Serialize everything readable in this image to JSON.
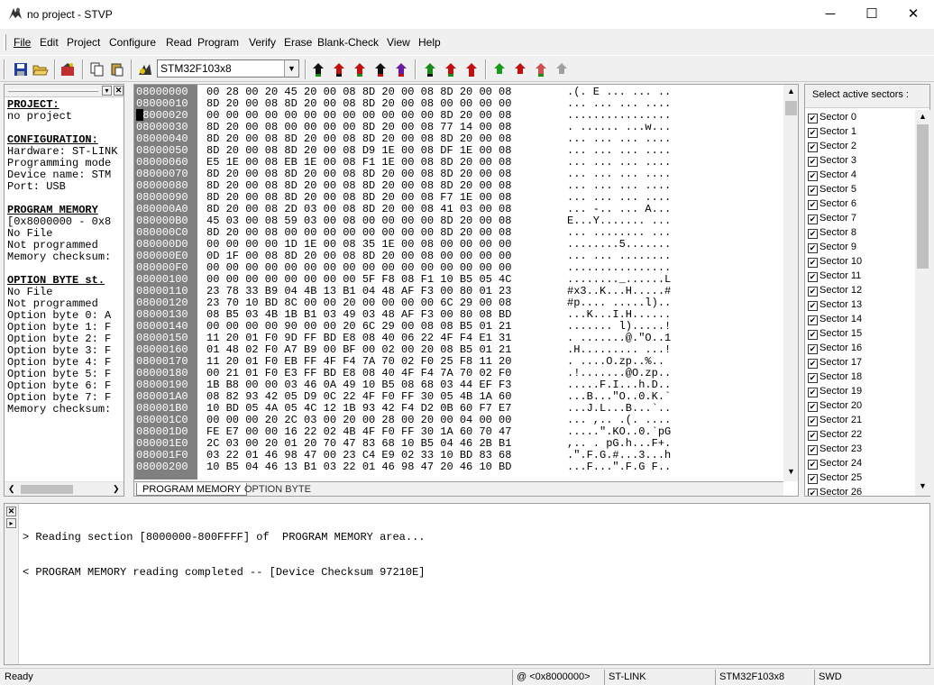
{
  "window": {
    "title": "no project - STVP",
    "minimize_label": "─",
    "maximize_label": "☐",
    "close_label": "✕"
  },
  "menu": [
    "File",
    "Edit",
    "Project",
    "Configure",
    "Read",
    "Program",
    "Verify",
    "Erase",
    "Blank-Check",
    "View",
    "Help"
  ],
  "toolbar": {
    "device": "STM32F103x8",
    "icons": [
      "save-icon",
      "open-icon",
      "project-icon",
      "copy-icon",
      "paste-icon",
      "device-icon",
      "read-all-icon",
      "read-icon",
      "read-program-icon",
      "read-option-icon",
      "read-data-icon",
      "program-all-icon",
      "program-icon",
      "program-current-icon",
      "verify-all-icon",
      "verify-icon",
      "verify-current-icon",
      "disabled-icon"
    ]
  },
  "left_panel": {
    "lines": [
      {
        "text": "PROJECT:",
        "heading": true
      },
      {
        "text": "no project",
        "heading": false
      },
      {
        "text": "",
        "heading": false
      },
      {
        "text": "CONFIGURATION:",
        "heading": true
      },
      {
        "text": "Hardware: ST-LINK",
        "heading": false
      },
      {
        "text": "Programming mode",
        "heading": false
      },
      {
        "text": "Device name: STM",
        "heading": false
      },
      {
        "text": "Port: USB",
        "heading": false
      },
      {
        "text": "",
        "heading": false
      },
      {
        "text": "PROGRAM MEMORY",
        "heading": true
      },
      {
        "text": "[0x8000000 - 0x8",
        "heading": false
      },
      {
        "text": "No File",
        "heading": false
      },
      {
        "text": "Not programmed",
        "heading": false
      },
      {
        "text": "Memory checksum:",
        "heading": false
      },
      {
        "text": "",
        "heading": false
      },
      {
        "text": "OPTION BYTE st.",
        "heading": true
      },
      {
        "text": "No File",
        "heading": false
      },
      {
        "text": "Not programmed",
        "heading": false
      },
      {
        "text": "Option byte 0: A",
        "heading": false
      },
      {
        "text": "Option byte 1: F",
        "heading": false
      },
      {
        "text": "Option byte 2: F",
        "heading": false
      },
      {
        "text": "Option byte 3: F",
        "heading": false
      },
      {
        "text": "Option byte 4: F",
        "heading": false
      },
      {
        "text": "Option byte 5: F",
        "heading": false
      },
      {
        "text": "Option byte 6: F",
        "heading": false
      },
      {
        "text": "Option byte 7: F",
        "heading": false
      },
      {
        "text": "Memory checksum:",
        "heading": false
      }
    ]
  },
  "memory": {
    "rows": [
      {
        "addr": "08000000",
        "hex": "00 28 00 20 45 20 00 08 8D 20 00 08 8D 20 00 08",
        "ascii": ".(. E ... ... .."
      },
      {
        "addr": "08000010",
        "hex": "8D 20 00 08 8D 20 00 08 8D 20 00 08 00 00 00 00",
        "ascii": "... ... ... ...."
      },
      {
        "addr": "08000020",
        "hex": "00 00 00 00 00 00 00 00 00 00 00 00 8D 20 00 08",
        "ascii": "................"
      },
      {
        "addr": "08000030",
        "hex": "8D 20 00 08 00 00 00 00 8D 20 00 08 77 14 00 08",
        "ascii": ". ...... ...w..."
      },
      {
        "addr": "08000040",
        "hex": "8D 20 00 08 8D 20 00 08 8D 20 00 08 8D 20 00 08",
        "ascii": "... ... ... ...."
      },
      {
        "addr": "08000050",
        "hex": "8D 20 00 08 8D 20 00 08 D9 1E 00 08 DF 1E 00 08",
        "ascii": "... ... ... ...."
      },
      {
        "addr": "08000060",
        "hex": "E5 1E 00 08 EB 1E 00 08 F1 1E 00 08 8D 20 00 08",
        "ascii": "... ... ... ...."
      },
      {
        "addr": "08000070",
        "hex": "8D 20 00 08 8D 20 00 08 8D 20 00 08 8D 20 00 08",
        "ascii": "... ... ... ...."
      },
      {
        "addr": "08000080",
        "hex": "8D 20 00 08 8D 20 00 08 8D 20 00 08 8D 20 00 08",
        "ascii": "... ... ... ...."
      },
      {
        "addr": "08000090",
        "hex": "8D 20 00 08 8D 20 00 08 8D 20 00 08 F7 1E 00 08",
        "ascii": "... ... ... ...."
      },
      {
        "addr": "080000A0",
        "hex": "8D 20 00 08 2D 03 00 08 8D 20 00 08 41 03 00 08",
        "ascii": "... -.. ... A..."
      },
      {
        "addr": "080000B0",
        "hex": "45 03 00 08 59 03 00 08 00 00 00 00 8D 20 00 08",
        "ascii": "E...Y....... ..."
      },
      {
        "addr": "080000C0",
        "hex": "8D 20 00 08 00 00 00 00 00 00 00 00 8D 20 00 08",
        "ascii": "... ........ ..."
      },
      {
        "addr": "080000D0",
        "hex": "00 00 00 00 1D 1E 00 08 35 1E 00 08 00 00 00 00",
        "ascii": "........5......."
      },
      {
        "addr": "080000E0",
        "hex": "0D 1F 00 08 8D 20 00 08 8D 20 00 08 00 00 00 00",
        "ascii": "... ... ........"
      },
      {
        "addr": "080000F0",
        "hex": "00 00 00 00 00 00 00 00 00 00 00 00 00 00 00 00",
        "ascii": "................"
      },
      {
        "addr": "08000100",
        "hex": "00 00 00 00 00 00 00 00 5F F8 08 F1 10 B5 05 4C",
        "ascii": "........_......L"
      },
      {
        "addr": "08000110",
        "hex": "23 78 33 B9 04 4B 13 B1 04 48 AF F3 00 80 01 23",
        "ascii": "#x3..K...H.....#"
      },
      {
        "addr": "08000120",
        "hex": "23 70 10 BD 8C 00 00 20 00 00 00 00 6C 29 00 08",
        "ascii": "#p.... .....l).."
      },
      {
        "addr": "08000130",
        "hex": "08 B5 03 4B 1B B1 03 49 03 48 AF F3 00 80 08 BD",
        "ascii": "...K...I.H......"
      },
      {
        "addr": "08000140",
        "hex": "00 00 00 00 90 00 00 20 6C 29 00 08 08 B5 01 21",
        "ascii": "....... l).....!"
      },
      {
        "addr": "08000150",
        "hex": "11 20 01 F0 9D FF BD E8 08 40 06 22 4F F4 E1 31",
        "ascii": ". .......@.\"O..1"
      },
      {
        "addr": "08000160",
        "hex": "01 48 02 F0 A7 B9 00 BF 00 02 00 20 08 B5 01 21",
        "ascii": ".H......... ...!"
      },
      {
        "addr": "08000170",
        "hex": "11 20 01 F0 EB FF 4F F4 7A 70 02 F0 25 F8 11 20",
        "ascii": ". ....O.zp..%.. "
      },
      {
        "addr": "08000180",
        "hex": "00 21 01 F0 E3 FF BD E8 08 40 4F F4 7A 70 02 F0",
        "ascii": ".!.......@O.zp.."
      },
      {
        "addr": "08000190",
        "hex": "1B B8 00 00 03 46 0A 49 10 B5 08 68 03 44 EF F3",
        "ascii": ".....F.I...h.D.."
      },
      {
        "addr": "080001A0",
        "hex": "08 82 93 42 05 D9 0C 22 4F F0 FF 30 05 4B 1A 60",
        "ascii": "...B...\"O..0.K.`"
      },
      {
        "addr": "080001B0",
        "hex": "10 BD 05 4A 05 4C 12 1B 93 42 F4 D2 0B 60 F7 E7",
        "ascii": "...J.L...B...`.."
      },
      {
        "addr": "080001C0",
        "hex": "00 00 00 20 2C 03 00 20 00 28 00 20 00 04 00 00",
        "ascii": "... ,.. .(. ...."
      },
      {
        "addr": "080001D0",
        "hex": "FE E7 00 00 16 22 02 4B 4F F0 FF 30 1A 60 70 47",
        "ascii": ".....\".KO..0.`pG"
      },
      {
        "addr": "080001E0",
        "hex": "2C 03 00 20 01 20 70 47 83 68 10 B5 04 46 2B B1",
        "ascii": ",.. . pG.h...F+."
      },
      {
        "addr": "080001F0",
        "hex": "03 22 01 46 98 47 00 23 C4 E9 02 33 10 BD 83 68",
        "ascii": ".\".F.G.#...3...h"
      },
      {
        "addr": "08000200",
        "hex": "10 B5 04 46 13 B1 03 22 01 46 98 47 20 46 10 BD",
        "ascii": "...F...\".F.G F.."
      }
    ],
    "tabs": [
      "PROGRAM MEMORY",
      "OPTION BYTE"
    ]
  },
  "sectors": {
    "header": "Select active sectors :",
    "items": [
      "Sector 0",
      "Sector 1",
      "Sector 2",
      "Sector 3",
      "Sector 4",
      "Sector 5",
      "Sector 6",
      "Sector 7",
      "Sector 8",
      "Sector 9",
      "Sector 10",
      "Sector 11",
      "Sector 12",
      "Sector 13",
      "Sector 14",
      "Sector 15",
      "Sector 16",
      "Sector 17",
      "Sector 18",
      "Sector 19",
      "Sector 20",
      "Sector 21",
      "Sector 22",
      "Sector 23",
      "Sector 24",
      "Sector 25",
      "Sector 26"
    ],
    "checked": true
  },
  "log": {
    "lines": [
      "> Reading section [8000000-800FFFF] of  PROGRAM MEMORY area...",
      "< PROGRAM MEMORY reading completed -- [Device Checksum 97210E]"
    ]
  },
  "status": {
    "ready": "Ready",
    "address": "@ <0x8000000>",
    "hardware": "ST-LINK",
    "device": "STM32F103x8",
    "protocol": "SWD"
  }
}
